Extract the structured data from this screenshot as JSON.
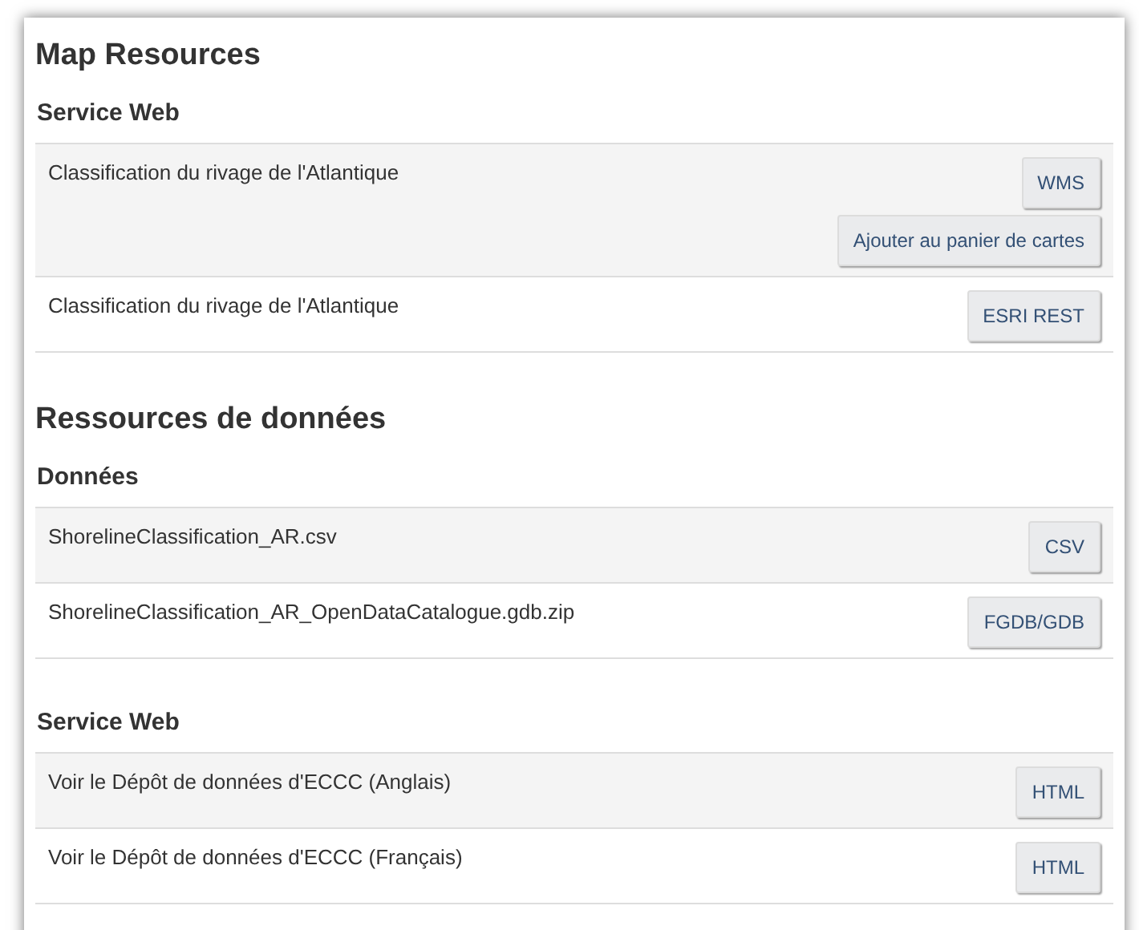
{
  "sections": [
    {
      "title": "Map Resources",
      "groups": [
        {
          "title": "Service Web",
          "rows": [
            {
              "label": "Classification du rivage de l'Atlantique",
              "buttons": [
                "WMS",
                "Ajouter au panier de cartes"
              ]
            },
            {
              "label": "Classification du rivage de l'Atlantique",
              "buttons": [
                "ESRI REST"
              ]
            }
          ]
        }
      ]
    },
    {
      "title": "Ressources de données",
      "groups": [
        {
          "title": "Données",
          "rows": [
            {
              "label": "ShorelineClassification_AR.csv",
              "buttons": [
                "CSV"
              ]
            },
            {
              "label": "ShorelineClassification_AR_OpenDataCatalogue.gdb.zip",
              "buttons": [
                "FGDB/GDB"
              ]
            }
          ]
        },
        {
          "title": "Service Web",
          "rows": [
            {
              "label": "Voir le Dépôt de données d'ECCC (Anglais)",
              "buttons": [
                "HTML"
              ]
            },
            {
              "label": "Voir le Dépôt de données d'ECCC (Français)",
              "buttons": [
                "HTML"
              ]
            }
          ]
        }
      ]
    }
  ]
}
